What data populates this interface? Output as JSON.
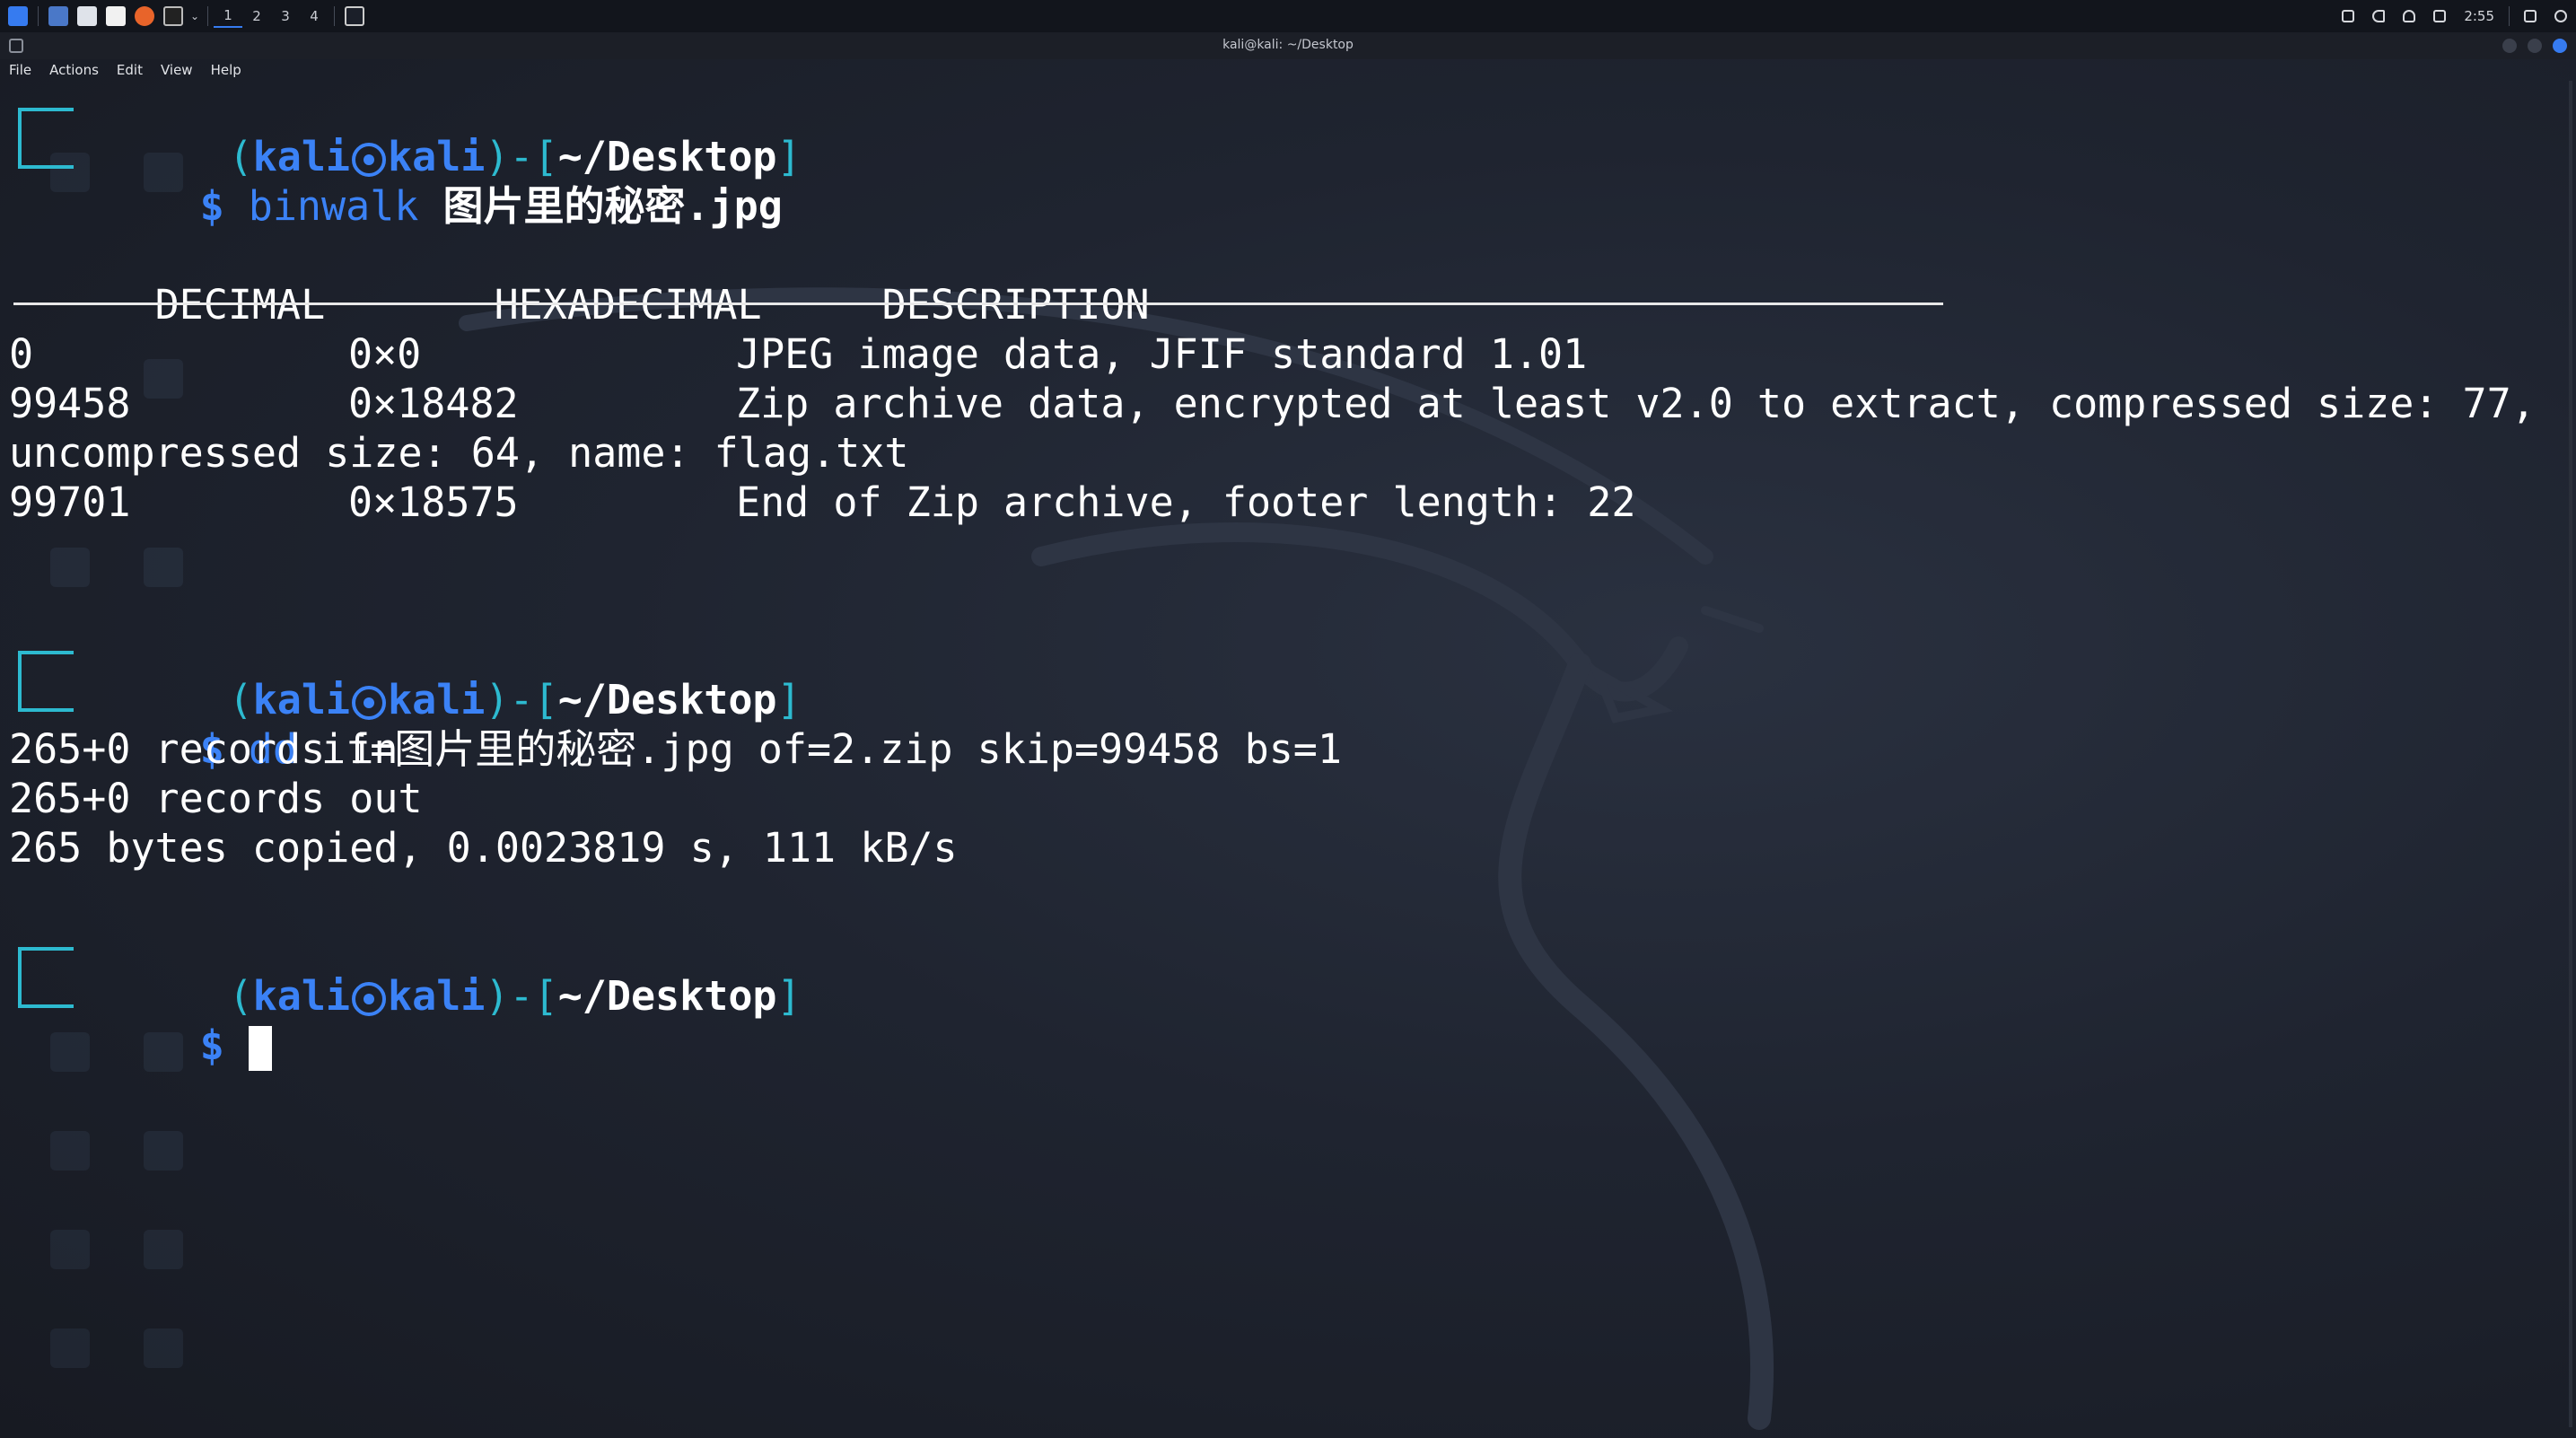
{
  "panel": {
    "workspaces": [
      "1",
      "2",
      "3",
      "4"
    ],
    "active_workspace": "1",
    "clock": "2:55"
  },
  "window": {
    "title": "kali@kali: ~/Desktop"
  },
  "menu": {
    "file": "File",
    "actions": "Actions",
    "edit": "Edit",
    "view": "View",
    "help": "Help"
  },
  "prompt": {
    "user": "kali",
    "host": "kali",
    "path": "~/Desktop",
    "symbol": "$"
  },
  "session": {
    "cmd1": {
      "program": "binwalk",
      "args": " 图片里的秘密.jpg"
    },
    "table": {
      "headers": [
        "DECIMAL",
        "HEXADECIMAL",
        "DESCRIPTION"
      ],
      "rows": [
        [
          "0",
          "0×0",
          "JPEG image data, JFIF standard 1.01"
        ],
        [
          "99458",
          "0×18482",
          "Zip archive data, encrypted at least v2.0 to extract, compressed size: 77,"
        ],
        [
          "99701",
          "0×18575",
          "End of Zip archive, footer length: 22"
        ]
      ],
      "wrap": "uncompressed size: 64, name: flag.txt"
    },
    "cmd2": {
      "program": "dd",
      "args": " if=图片里的秘密.jpg of=2.zip skip=99458 bs=1"
    },
    "output2": [
      "265+0 records in",
      "265+0 records out",
      "265 bytes copied, 0.0023819 s, 111 kB/s"
    ]
  },
  "colors": {
    "accent_blue": "#3b82f6",
    "prompt_teal": "#2dbad0",
    "background": "#1b1f29"
  }
}
